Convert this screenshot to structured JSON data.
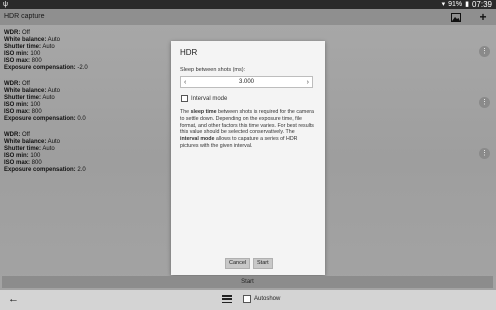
{
  "status_bar": {
    "time": "07:39",
    "battery": "91%",
    "left_icon": "usb-icon"
  },
  "app": {
    "title": "HDR capture",
    "gallery_icon": "image-icon",
    "add_icon": "plus-icon"
  },
  "settings_blocks": [
    {
      "wdr": {
        "k": "WDR:",
        "v": " Off"
      },
      "white_balance": {
        "k": "White balance:",
        "v": " Auto"
      },
      "shutter": {
        "k": "Shutter time:",
        "v": " Auto"
      },
      "iso_min": {
        "k": "ISO min:",
        "v": " 100"
      },
      "iso_max": {
        "k": "ISO max:",
        "v": " 800"
      },
      "exposure": {
        "k": "Exposure compensation:",
        "v": " -2.0"
      }
    },
    {
      "wdr": {
        "k": "WDR:",
        "v": " Off"
      },
      "white_balance": {
        "k": "White balance:",
        "v": " Auto"
      },
      "shutter": {
        "k": "Shutter time:",
        "v": " Auto"
      },
      "iso_min": {
        "k": "ISO min:",
        "v": " 100"
      },
      "iso_max": {
        "k": "ISO max:",
        "v": " 800"
      },
      "exposure": {
        "k": "Exposure compensation:",
        "v": " 0.0"
      }
    },
    {
      "wdr": {
        "k": "WDR:",
        "v": " Off"
      },
      "white_balance": {
        "k": "White balance:",
        "v": " Auto"
      },
      "shutter": {
        "k": "Shutter time:",
        "v": " Auto"
      },
      "iso_min": {
        "k": "ISO min:",
        "v": " 100"
      },
      "iso_max": {
        "k": "ISO max:",
        "v": " 800"
      },
      "exposure": {
        "k": "Exposure compensation:",
        "v": " 2.0"
      }
    }
  ],
  "dialog": {
    "title": "HDR",
    "sleep_label": "Sleep between shots (ms):",
    "sleep_value": "3.000",
    "decrement": "‹",
    "increment": "›",
    "interval_mode_label": "Interval mode",
    "desc_1": "The ",
    "desc_sleep_time": "sleep time",
    "desc_2": " between shots is required for the camera to settle down. Depending on the exposure time, file format, and other factors this time varies. For best results this value should be selected conservatively. The ",
    "desc_interval_mode": "interval mode",
    "desc_3": " allows to capature a series of HDR pictures with the given interval.",
    "cancel_label": "Cancel",
    "start_label": "Start"
  },
  "footer": {
    "start_label": "Start",
    "autoshow_label": "Autoshow"
  },
  "colors": {
    "dim_overlay": "#a4a4a4",
    "dialog_bg": "#f4f4f4",
    "status_bar": "#2a2a2a"
  }
}
